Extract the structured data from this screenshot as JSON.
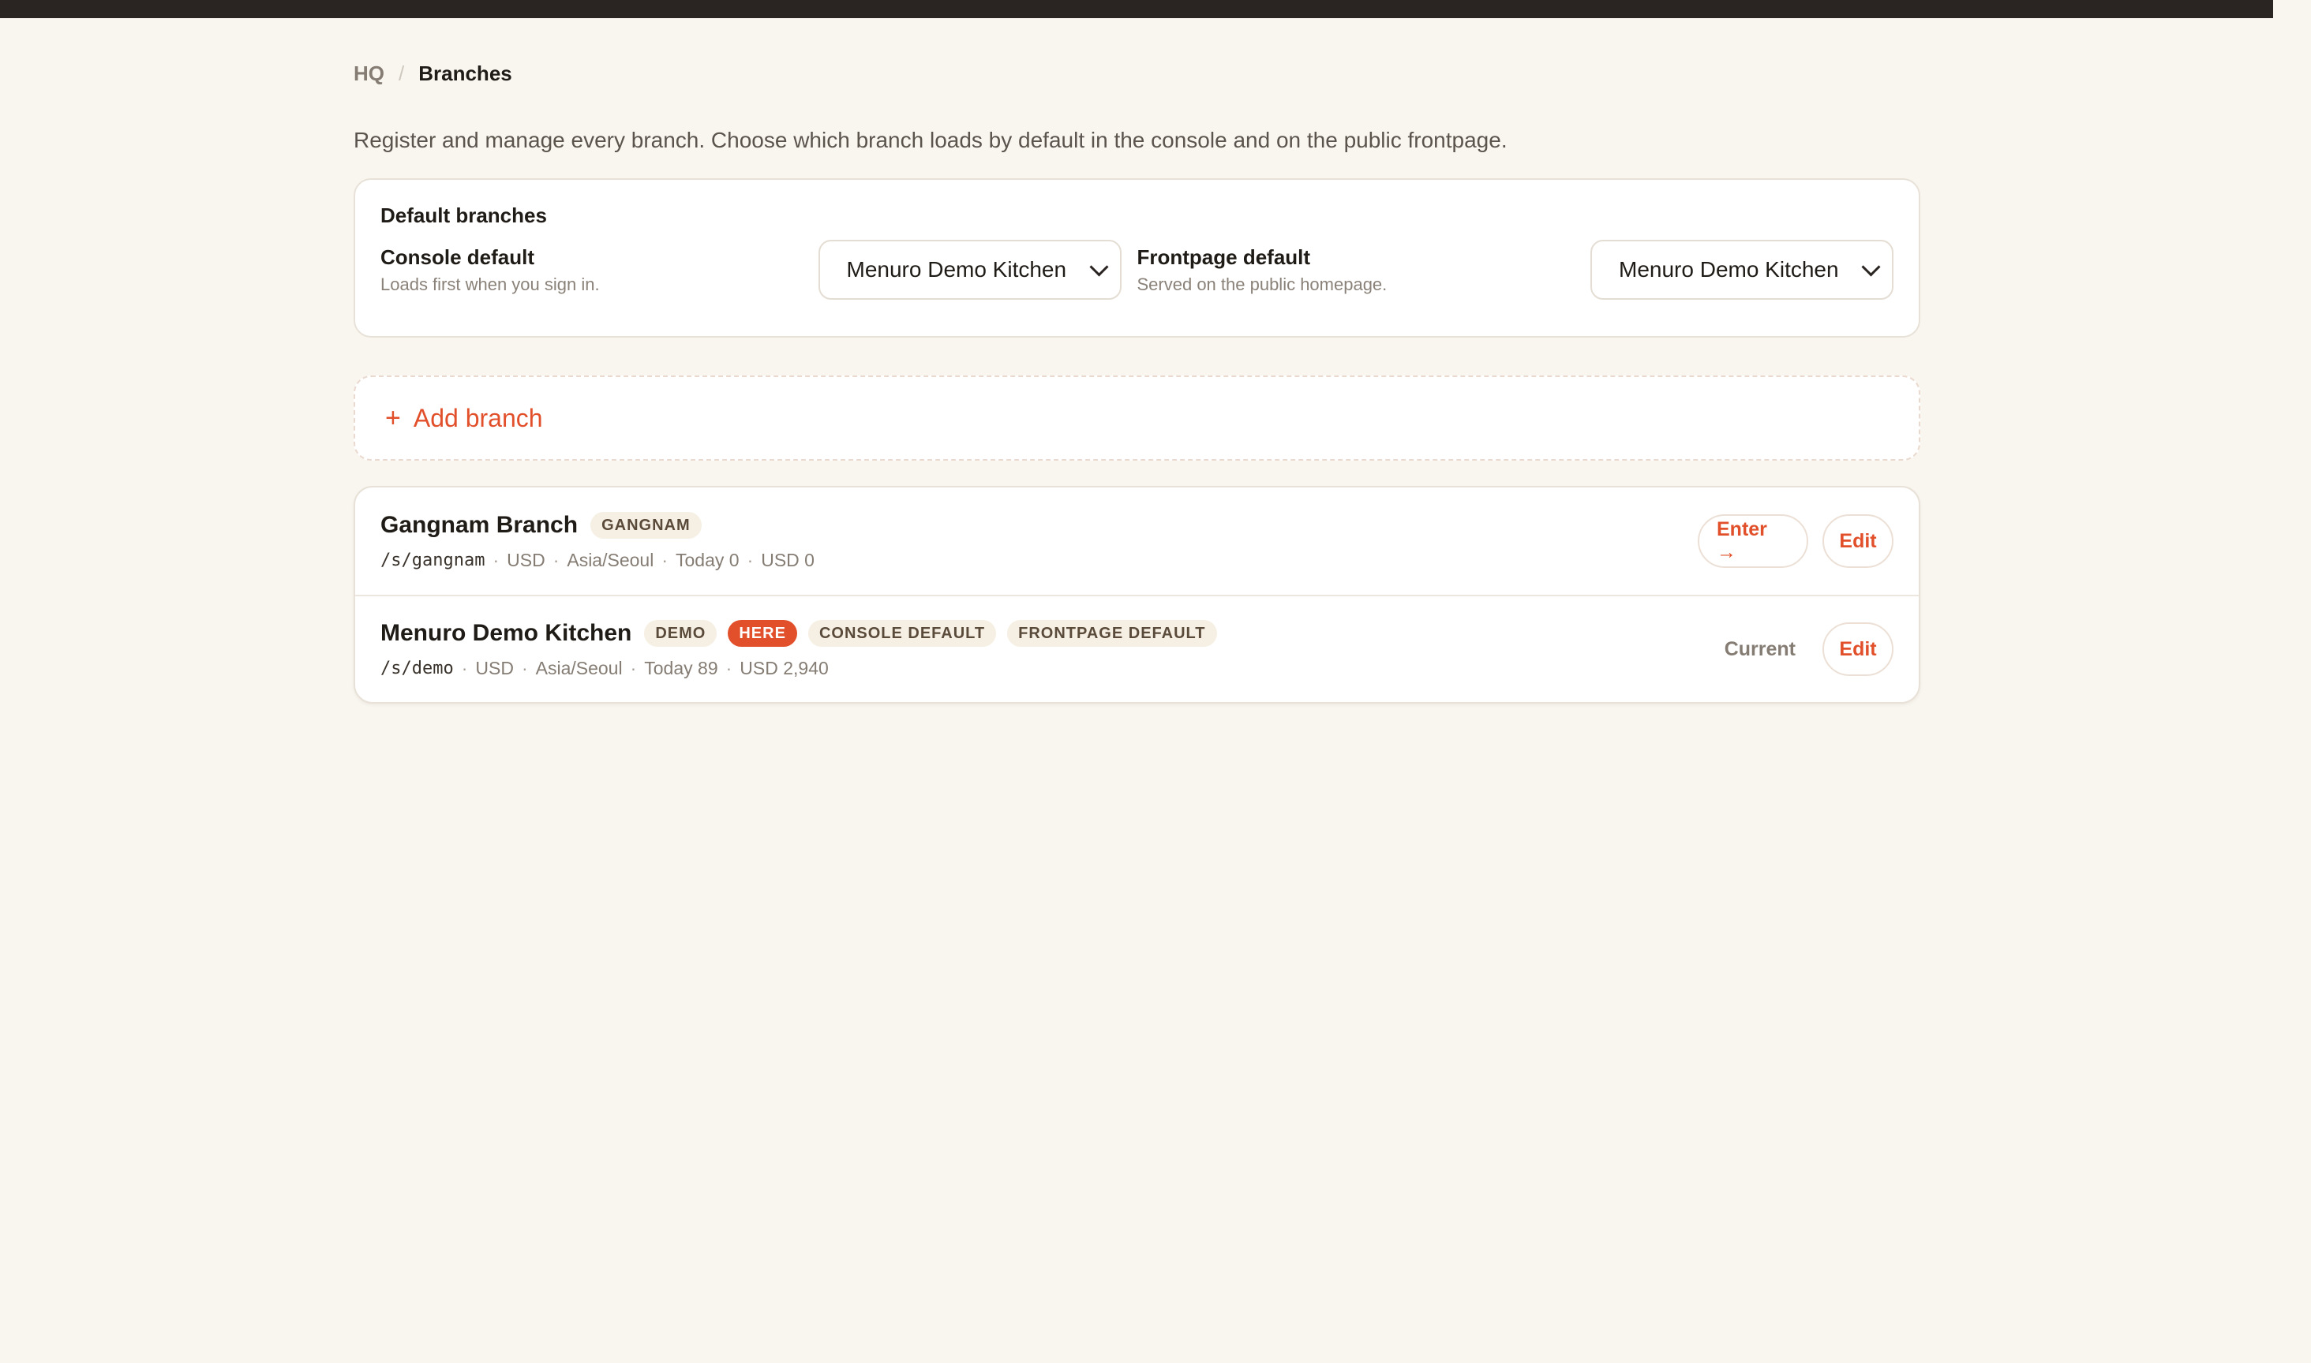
{
  "breadcrumb": {
    "root": "HQ",
    "separator": "/",
    "current": "Branches"
  },
  "intro": "Register and manage every branch. Choose which branch loads by default in the console and on the public frontpage.",
  "defaults": {
    "title": "Default branches",
    "console": {
      "label": "Console default",
      "help": "Loads first when you sign in.",
      "selected": "Menuro Demo Kitchen"
    },
    "frontpage": {
      "label": "Frontpage default",
      "help": "Served on the public homepage.",
      "selected": "Menuro Demo Kitchen"
    }
  },
  "add_branch": {
    "icon": "plus-icon",
    "plus": "+",
    "label": "Add branch"
  },
  "branches": [
    {
      "name": "Gangnam Branch",
      "tags": [
        "GANGNAM"
      ],
      "path": "/s/gangnam",
      "currency": "USD",
      "timezone": "Asia/Seoul",
      "today": "Today 0",
      "revenue": "USD 0",
      "enter_label": "Enter →",
      "edit_label": "Edit"
    },
    {
      "name": "Menuro Demo Kitchen",
      "tags": [
        "DEMO",
        "HERE",
        "CONSOLE DEFAULT",
        "FRONTPAGE DEFAULT"
      ],
      "path": "/s/demo",
      "currency": "USD",
      "timezone": "Asia/Seoul",
      "today": "Today 89",
      "revenue": "USD 2,940",
      "current_label": "Current",
      "edit_label": "Edit"
    }
  ],
  "meta_separator": "·",
  "colors": {
    "accent": "#e1502b",
    "background": "#f9f6f0",
    "topbar": "#2a2522"
  }
}
